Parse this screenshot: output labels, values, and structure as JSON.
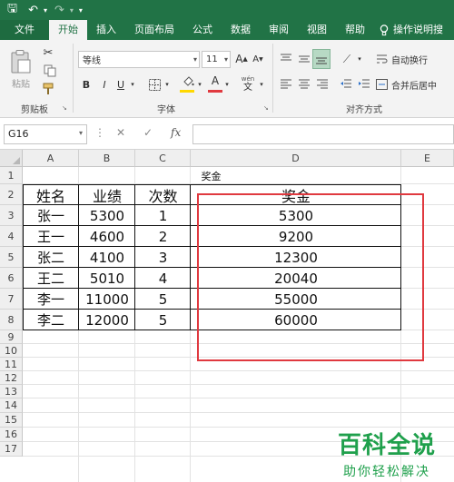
{
  "qat": {
    "save": "🖫",
    "undo": "↶",
    "redo": "↷",
    "customize": "▾"
  },
  "tabs": [
    "文件",
    "开始",
    "插入",
    "页面布局",
    "公式",
    "数据",
    "审阅",
    "视图",
    "帮助"
  ],
  "search_tab": {
    "icon": "lightbulb-icon",
    "label": "操作说明搜"
  },
  "ribbon": {
    "clipboard": {
      "paste": "粘贴",
      "label": "剪贴板"
    },
    "font": {
      "name": "等线",
      "size": "11",
      "grow": "A",
      "shrink": "A",
      "bold": "B",
      "italic": "I",
      "underline": "U",
      "color_a": "A",
      "phonetic": "wén",
      "label": "字体",
      "fill_color": "#ffd800",
      "font_color": "#e0393f"
    },
    "alignment": {
      "wrap": "自动换行",
      "merge": "合并后居中",
      "label": "对齐方式"
    }
  },
  "formula_bar": {
    "name_box": "G16",
    "fx": "fx",
    "cancel": "✕",
    "enter": "✓"
  },
  "columns": [
    "A",
    "B",
    "C",
    "D",
    "E"
  ],
  "rows": [
    "1",
    "2",
    "3",
    "4",
    "5",
    "6",
    "7",
    "8",
    "9",
    "10",
    "11",
    "12",
    "13",
    "14",
    "15",
    "16",
    "17"
  ],
  "sheet": {
    "title": "奖金",
    "headers": [
      "姓名",
      "业绩",
      "次数",
      "奖金"
    ],
    "rows": [
      [
        "张一",
        "5300",
        "1",
        "5300"
      ],
      [
        "王一",
        "4600",
        "2",
        "9200"
      ],
      [
        "张二",
        "4100",
        "3",
        "12300"
      ],
      [
        "王二",
        "5010",
        "4",
        "20040"
      ],
      [
        "李一",
        "11000",
        "5",
        "55000"
      ],
      [
        "李二",
        "12000",
        "5",
        "60000"
      ]
    ]
  },
  "annotation": {
    "color": "#e0393f"
  },
  "watermark": {
    "title": "百科全说",
    "subtitle": "助你轻松解决"
  }
}
